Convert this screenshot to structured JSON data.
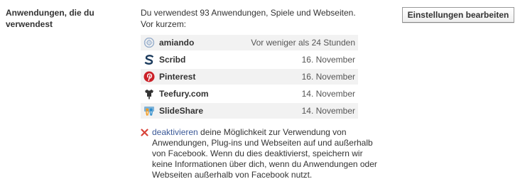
{
  "section": {
    "label": "Anwendungen, die du verwendest"
  },
  "intro_text": "Du verwendest 93 Anwendungen, Spiele und Webseiten. Vor kurzem:",
  "apps": [
    {
      "name": "amiando",
      "date": "Vor weniger als 24 Stunden",
      "icon": "amiando-icon"
    },
    {
      "name": "Scribd",
      "date": "16. November",
      "icon": "scribd-icon"
    },
    {
      "name": "Pinterest",
      "date": "16. November",
      "icon": "pinterest-icon"
    },
    {
      "name": "Teefury.com",
      "date": "14. November",
      "icon": "teefury-icon"
    },
    {
      "name": "SlideShare",
      "date": "14. November",
      "icon": "slideshare-icon"
    }
  ],
  "deactivate": {
    "link_text": "deaktivieren",
    "text": " deine Möglichkeit zur Verwendung von Anwendungen, Plug-ins und Webseiten auf und außerhalb von Facebook. Wenn du dies deaktivierst, speichern wir keine Informationen über dich, wenn du Anwendungen oder Webseiten außerhalb von Facebook nutzt.",
    "icon": "red-x-icon"
  },
  "edit_button_label": "Einstellungen bearbeiten",
  "colors": {
    "link": "#3b5998",
    "row_bg": "#f2f2f2",
    "deactivate_icon": "#d8443a"
  }
}
